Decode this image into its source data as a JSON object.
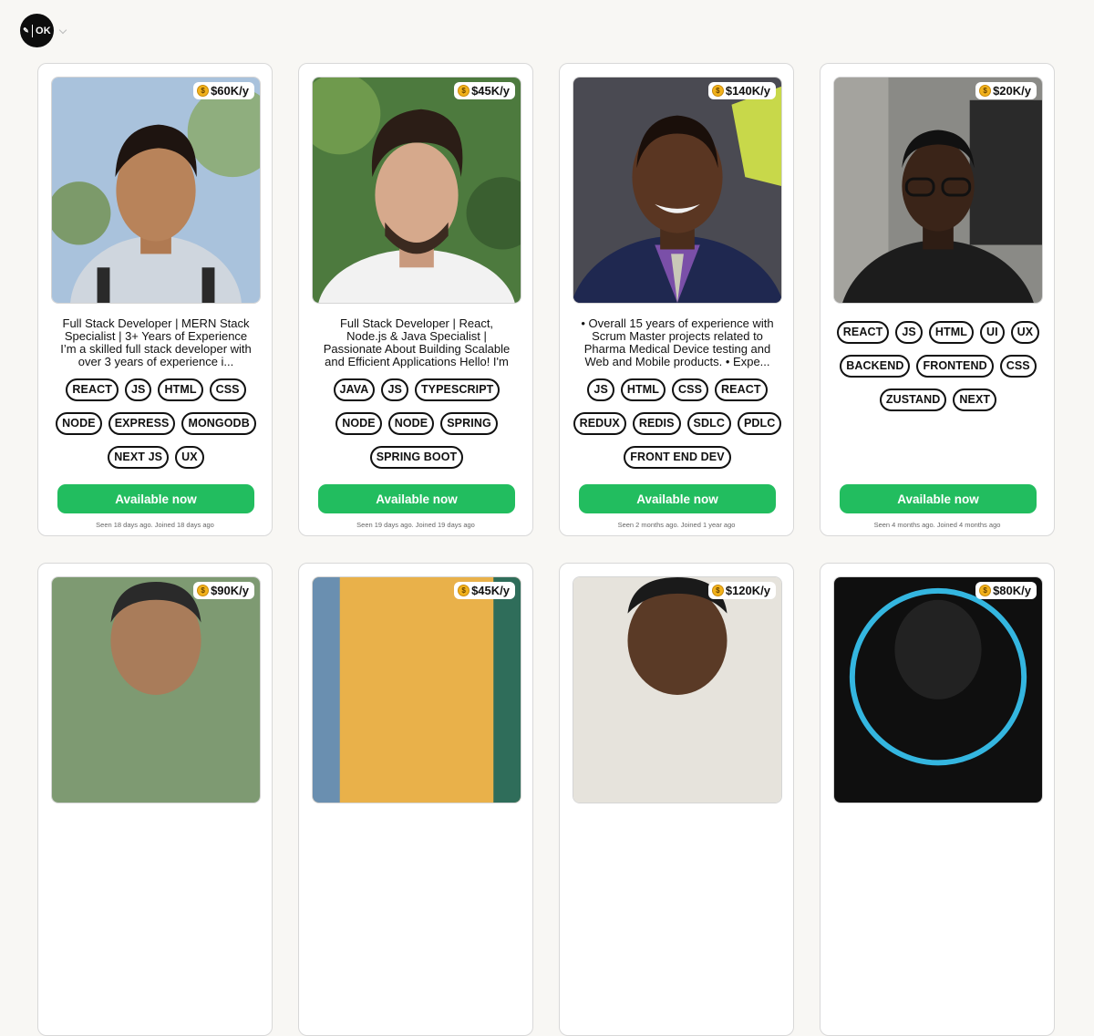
{
  "app": {
    "logo_text": "OK"
  },
  "cards": [
    {
      "salary": "$60K/y",
      "description": "Full Stack Developer | MERN Stack Specialist | 3+ Years of Experience I’m a skilled full stack developer with over 3 years of experience i...",
      "tags": [
        "REACT",
        "JS",
        "HTML",
        "CSS",
        "NODE",
        "EXPRESS",
        "MONGODB",
        "NEXT JS",
        "UX"
      ],
      "status": "Available now",
      "seen": "Seen 18 days ago. Joined 18 days ago"
    },
    {
      "salary": "$45K/y",
      "description": "Full Stack Developer | React, Node.js & Java Specialist | Passionate About Building Scalable and Efficient Applications Hello! I'm Arthur d...",
      "tags": [
        "JAVA",
        "JS",
        "TYPESCRIPT",
        "NODE",
        "NODE",
        "SPRING",
        "SPRING BOOT"
      ],
      "status": "Available now",
      "seen": "Seen 19 days ago. Joined 19 days ago"
    },
    {
      "salary": "$140K/y",
      "description": "• Overall 15 years of experience with Scrum Master projects related to Pharma Medical Device testing and Web and Mobile products. • Expe...",
      "tags": [
        "JS",
        "HTML",
        "CSS",
        "REACT",
        "REDUX",
        "REDIS",
        "SDLC",
        "PDLC",
        "FRONT END DEV"
      ],
      "status": "Available now",
      "seen": "Seen 2 months ago. Joined 1 year ago"
    },
    {
      "salary": "$20K/y",
      "description": "",
      "tags": [
        "REACT",
        "JS",
        "HTML",
        "UI",
        "UX",
        "BACKEND",
        "FRONTEND",
        "CSS",
        "ZUSTAND",
        "NEXT"
      ],
      "status": "Available now",
      "seen": "Seen 4 months ago. Joined 4 months ago"
    },
    {
      "salary": "$90K/y"
    },
    {
      "salary": "$45K/y"
    },
    {
      "salary": "$120K/y"
    },
    {
      "salary": "$80K/y"
    }
  ]
}
